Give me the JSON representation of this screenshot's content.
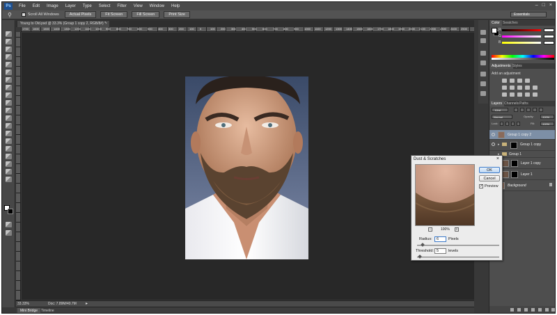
{
  "menubar": {
    "logo": "Ps",
    "items": [
      "File",
      "Edit",
      "Image",
      "Layer",
      "Type",
      "Select",
      "Filter",
      "View",
      "Window",
      "Help"
    ]
  },
  "options_bar": {
    "checkbox_label": "Scroll All Windows",
    "buttons": [
      "Actual Pixels",
      "Fit Screen",
      "Fill Screen",
      "Print Size"
    ],
    "workspace": "Essentials"
  },
  "document": {
    "tab_title": "Young to Old.psd @ 33.3% (Group 1 copy 2, RGB/8#) *"
  },
  "ruler_labels": [
    "1700",
    "1600",
    "1500",
    "1400",
    "1300",
    "1200",
    "1100",
    "1000",
    "900",
    "800",
    "700",
    "600",
    "500",
    "400",
    "300",
    "200",
    "100",
    "0",
    "100",
    "200",
    "300",
    "400",
    "500",
    "600",
    "700",
    "800",
    "900",
    "1000",
    "1100",
    "1200",
    "1300",
    "1400",
    "1500",
    "1600",
    "1700",
    "1800",
    "1900",
    "2000",
    "2100",
    "2200",
    "2300",
    "2400",
    "2500"
  ],
  "statusbar": {
    "zoom": "33.33%",
    "doc_info": "Doc: 7.89M/40.7M"
  },
  "bottom_tabs": [
    "Mini Bridge",
    "Timeline"
  ],
  "panels": {
    "color_tabs": [
      "Color",
      "Swatches"
    ],
    "color_channels": [
      "R",
      "G",
      "B"
    ],
    "adjust_tabs": [
      "Adjustments",
      "Styles"
    ],
    "adjust_label": "Add an adjustment",
    "layers_tabs": [
      "Layers",
      "Channels",
      "Paths"
    ],
    "blend_mode": "Normal",
    "opacity_label": "Opacity:",
    "opacity_value": "100%",
    "fill_label": "Fill:",
    "fill_value": "100%",
    "lock_label": "Lock:",
    "kind_label": "Kind",
    "layers": [
      {
        "name": "Group 1 copy 2",
        "selected": true
      },
      {
        "name": "Group 1 copy"
      },
      {
        "name": "Group 1"
      },
      {
        "name": "Layer 1 copy"
      },
      {
        "name": "Layer 1"
      },
      {
        "name": "Background"
      }
    ]
  },
  "dialog": {
    "title": "Dust & Scratches",
    "ok": "OK",
    "cancel": "Cancel",
    "preview_label": "Preview",
    "zoom_pct": "100%",
    "radius_label": "Radius:",
    "radius_value": "6",
    "radius_unit": "Pixels",
    "radius_level": 0.05,
    "threshold_label": "Threshold:",
    "threshold_value": "5",
    "threshold_unit": "levels",
    "threshold_level": 0.02
  },
  "colors": {
    "app_bg": "#383838",
    "canvas_bg": "#282828",
    "panel_bg": "#4e4e4e",
    "selected_layer": "#7d8fa6",
    "dialog_bg": "#ececec"
  }
}
